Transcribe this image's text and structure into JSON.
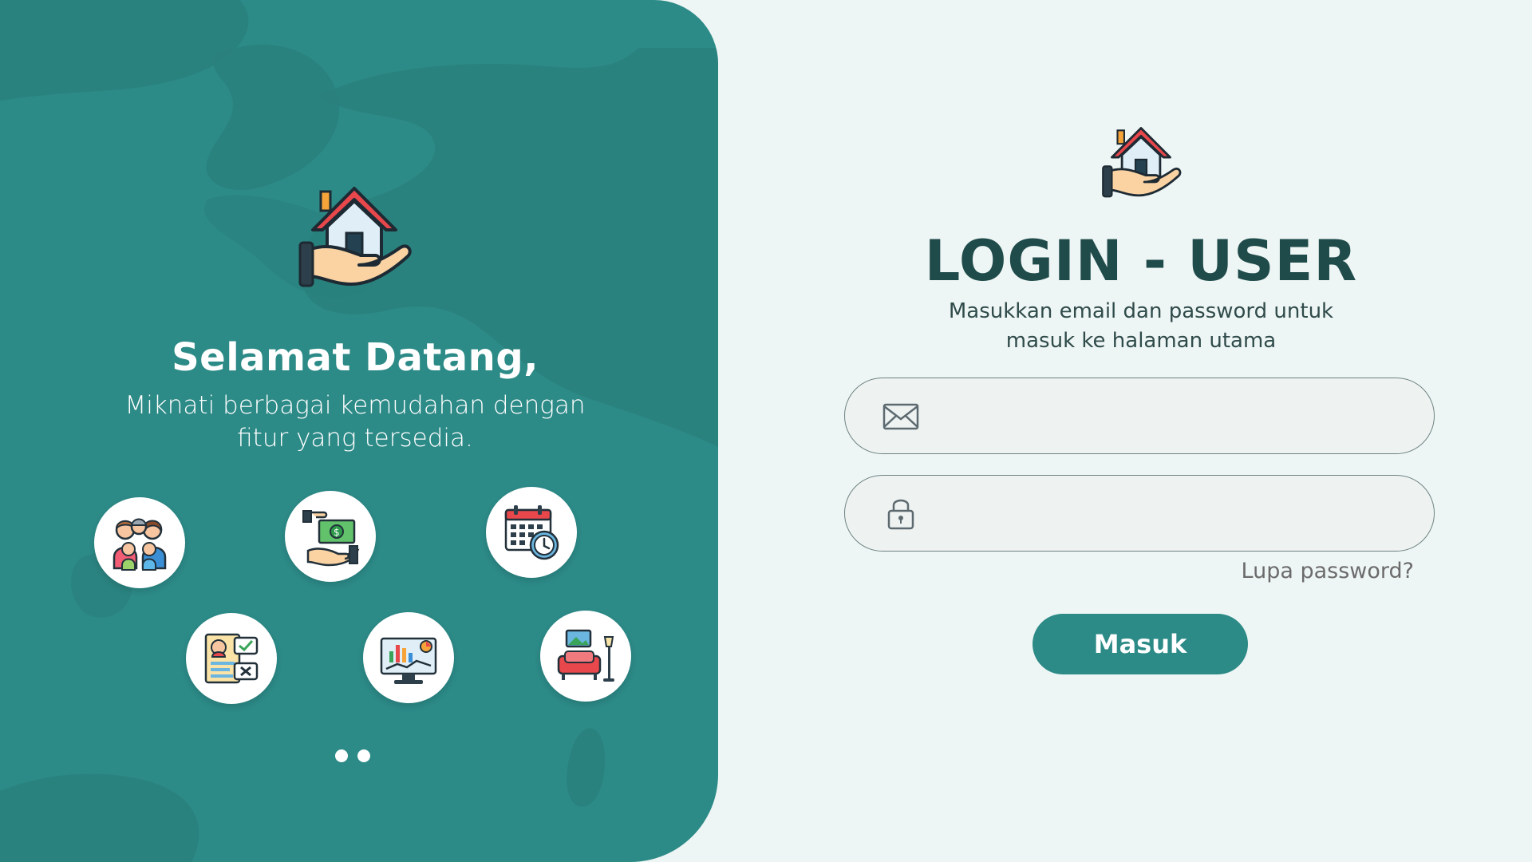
{
  "welcome": {
    "logo_icon": "house-in-hand-icon",
    "title": "Selamat Datang,",
    "subtitle": "Miknati berbagai kemudahan dengan fitur yang tersedia."
  },
  "features": [
    {
      "icon": "family-icon"
    },
    {
      "icon": "payment-hand-icon"
    },
    {
      "icon": "calendar-clock-icon"
    },
    {
      "icon": "resume-checklist-icon"
    },
    {
      "icon": "analytics-monitor-icon"
    },
    {
      "icon": "furniture-room-icon"
    }
  ],
  "carousel": {
    "dots": 2,
    "active": 0
  },
  "login": {
    "logo_icon": "house-in-hand-icon",
    "title": "LOGIN - USER",
    "subtitle": "Masukkan email dan password untuk masuk ke halaman utama",
    "email": {
      "icon": "envelope-icon",
      "value": "",
      "placeholder": ""
    },
    "password": {
      "icon": "padlock-icon",
      "value": "",
      "placeholder": ""
    },
    "forgot_label": "Lupa password?",
    "submit_label": "Masuk"
  },
  "colors": {
    "primary": "#2c8a87",
    "background": "#eef6f5",
    "title_text": "#1f4b4a"
  }
}
